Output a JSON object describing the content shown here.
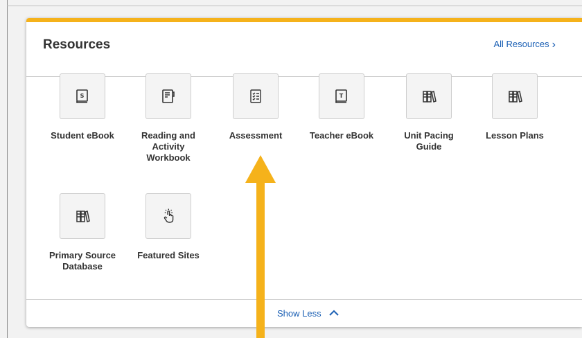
{
  "panel": {
    "title": "Resources",
    "all_resources_label": "All Resources",
    "show_less_label": "Show Less",
    "accent_color": "#f5b21b",
    "link_color": "#1a5fb4"
  },
  "tiles": [
    {
      "label": "Student eBook",
      "icon": "student-ebook-icon"
    },
    {
      "label": "Reading and Activity Workbook",
      "icon": "workbook-icon"
    },
    {
      "label": "Assessment",
      "icon": "assessment-checklist-icon"
    },
    {
      "label": "Teacher eBook",
      "icon": "teacher-ebook-icon"
    },
    {
      "label": "Unit Pacing Guide",
      "icon": "binders-icon"
    },
    {
      "label": "Lesson Plans",
      "icon": "binders-icon"
    },
    {
      "label": "Primary Source Database",
      "icon": "binders-icon"
    },
    {
      "label": "Featured Sites",
      "icon": "hand-pointer-icon"
    }
  ],
  "annotation": {
    "arrow_color": "#f5b21b",
    "points_to": "Assessment"
  }
}
